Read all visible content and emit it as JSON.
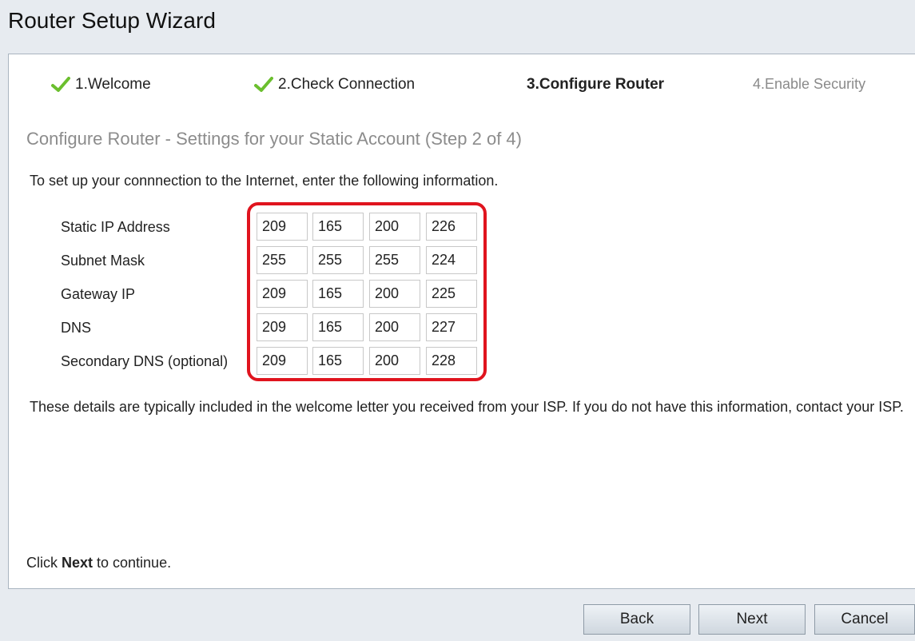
{
  "window": {
    "title": "Router Setup Wizard"
  },
  "steps": [
    {
      "label": "1.Welcome",
      "state": "done",
      "icon": "check-icon"
    },
    {
      "label": "2.Check Connection",
      "state": "done",
      "icon": "check-icon"
    },
    {
      "label": "3.Configure Router",
      "state": "current"
    },
    {
      "label": "4.Enable Security",
      "state": "upcoming"
    }
  ],
  "section": {
    "heading": "Configure Router - Settings for your Static Account (Step 2 of 4)",
    "intro": "To set up your connnection to the Internet, enter the following information."
  },
  "fields": [
    {
      "label": "Static IP Address",
      "octets": [
        "209",
        "165",
        "200",
        "226"
      ]
    },
    {
      "label": "Subnet Mask",
      "octets": [
        "255",
        "255",
        "255",
        "224"
      ]
    },
    {
      "label": "Gateway IP",
      "octets": [
        "209",
        "165",
        "200",
        "225"
      ]
    },
    {
      "label": "DNS",
      "octets": [
        "209",
        "165",
        "200",
        "227"
      ]
    },
    {
      "label": "Secondary DNS (optional)",
      "octets": [
        "209",
        "165",
        "200",
        "228"
      ]
    }
  ],
  "note": "These details are typically included in the welcome letter you received from your ISP. If you do not have this information, contact your ISP.",
  "continue": {
    "prefix": "Click ",
    "bold": "Next",
    "suffix": " to continue."
  },
  "buttons": {
    "back": "Back",
    "next": "Next",
    "cancel": "Cancel"
  },
  "colors": {
    "highlight": "#e0141e",
    "check": "#6bbf2e",
    "heading": "#8c8c8c"
  }
}
